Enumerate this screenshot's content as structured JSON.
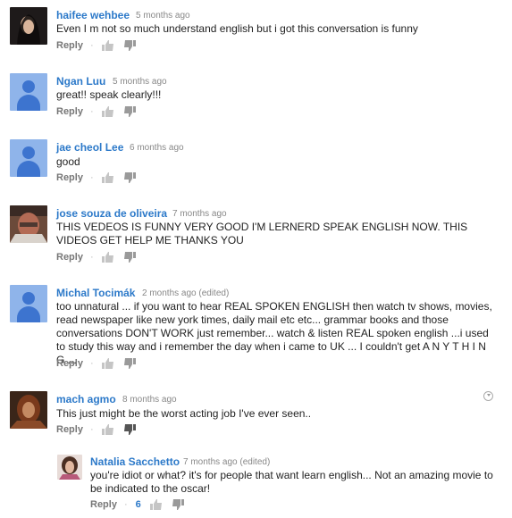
{
  "comments": [
    {
      "author": "haifee wehbee",
      "time": "5 months ago",
      "text": "Even I m not so much understand english but i got this conversation is funny",
      "reply": "Reply",
      "avatar": "photo-dark-hair"
    },
    {
      "author": "Ngan Luu",
      "time": "5 months ago",
      "text": "great!! speak clearly!!!",
      "reply": "Reply",
      "avatar": "default-user-icon"
    },
    {
      "author": "jae cheol Lee",
      "time": "6 months ago",
      "text": "good",
      "reply": "Reply",
      "avatar": "default-user-icon"
    },
    {
      "author": "jose souza de oliveira",
      "time": "7 months ago",
      "text": "THIS VEDEOS IS FUNNY VERY GOOD I'M LERNERD SPEAK ENGLISH NOW. THIS VIDEOS GET HELP ME THANKS YOU",
      "reply": "Reply",
      "avatar": "photo-man"
    },
    {
      "author": "Michal Tocimák",
      "time": "2 months ago (edited)",
      "text": "too unnatural ... if you want to hear REAL SPOKEN ENGLISH then watch tv shows, movies, read newspaper like new york times, daily mail etc etc... grammar books and those conversations DON'T WORK just remember... watch & listen REAL spoken english ...i used to study this way and i remember the day when i came to UK ... I couldn't get A N Y T H I N G ...",
      "reply": "Reply",
      "avatar": "default-user-icon"
    },
    {
      "author": "mach agmo",
      "time": "8 months ago",
      "text": "This just might be the worst acting job I've ever seen..",
      "reply": "Reply",
      "avatar": "photo-woman-red"
    }
  ],
  "reply_comment": {
    "author": "Natalia Sacchetto",
    "time": "7 months ago (edited)",
    "text": "you're idiot or what? it's for people that want learn english... Not an amazing movie to be indicated  to the oscar!",
    "reply": "Reply",
    "likes": "6",
    "avatar": "photo-woman"
  },
  "colors": {
    "author": "#2c79c9",
    "meta": "#888888",
    "text": "#222222"
  }
}
